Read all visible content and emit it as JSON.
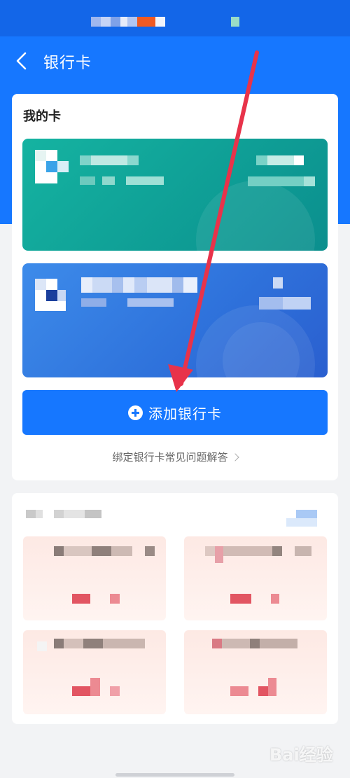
{
  "nav": {
    "title": "银行卡",
    "back_icon": "chevron-left-icon"
  },
  "cards_section": {
    "title": "我的卡",
    "cards": [
      {
        "id": "card-1",
        "color": "#12a89a"
      },
      {
        "id": "card-2",
        "color": "#3078df"
      }
    ],
    "add_button_label": "添加银行卡",
    "faq_label": "绑定银行卡常见问题解答"
  },
  "colors": {
    "primary": "#1677ff",
    "background": "#f2f3f5",
    "arrow": "#e8334a"
  },
  "watermark": "Bai经验"
}
